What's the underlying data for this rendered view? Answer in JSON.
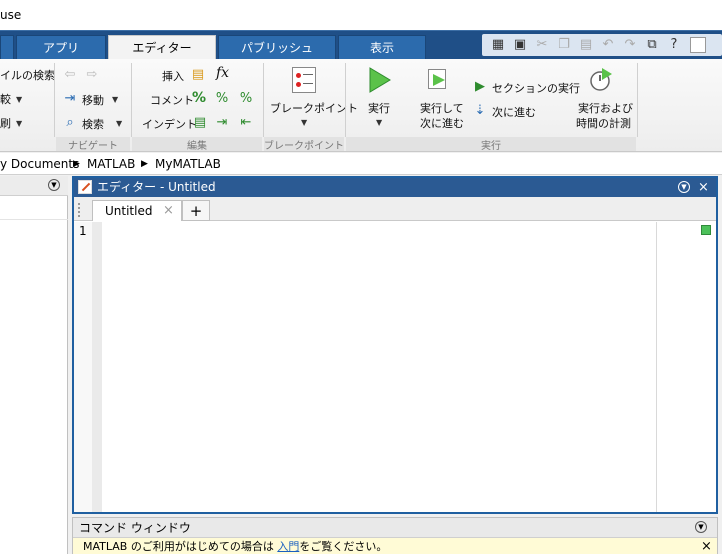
{
  "window": {
    "title": "use"
  },
  "tabs": [
    {
      "label": "アプリ"
    },
    {
      "label": "エディター"
    },
    {
      "label": "パブリッシュ"
    },
    {
      "label": "表示"
    }
  ],
  "ribbon": {
    "file": {
      "find_files": "イルの検索",
      "compare": "較",
      "print": "刷"
    },
    "navigate": {
      "group_label": "ナビゲート",
      "goto": "移動",
      "find": "検索"
    },
    "edit": {
      "group_label": "編集",
      "insert": "挿入",
      "fx": "fx",
      "comment": "コメント",
      "comment_symbol": "%",
      "indent": "インデント"
    },
    "breakpoints": {
      "group_label": "ブレークポイント",
      "button": "ブレークポイント"
    },
    "run": {
      "group_label": "実行",
      "run": "実行",
      "run_advance_1": "実行して",
      "run_advance_2": "次に進む",
      "run_section": "セクションの実行",
      "advance": "次に進む",
      "run_time_1": "実行および",
      "run_time_2": "時間の計測"
    }
  },
  "path": {
    "segments": [
      "y Documents",
      "MATLAB",
      "MyMATLAB"
    ],
    "separator": "▶"
  },
  "editor": {
    "header_title": "エディター - Untitled",
    "file_tab": "Untitled",
    "add_tab": "+",
    "line_number": "1"
  },
  "command_window": {
    "title": "コマンド ウィンドウ",
    "notice_prefix": "MATLAB のご利用がはじめての場合は ",
    "notice_link": "入門",
    "notice_suffix": "をご覧ください。"
  },
  "icons": {
    "close": "×",
    "dropdown": "⊙",
    "caret": "▼"
  },
  "colors": {
    "tabstrip": "#1f4f87",
    "editor_header": "#2b5a93",
    "run_green": "#3aa83a"
  }
}
